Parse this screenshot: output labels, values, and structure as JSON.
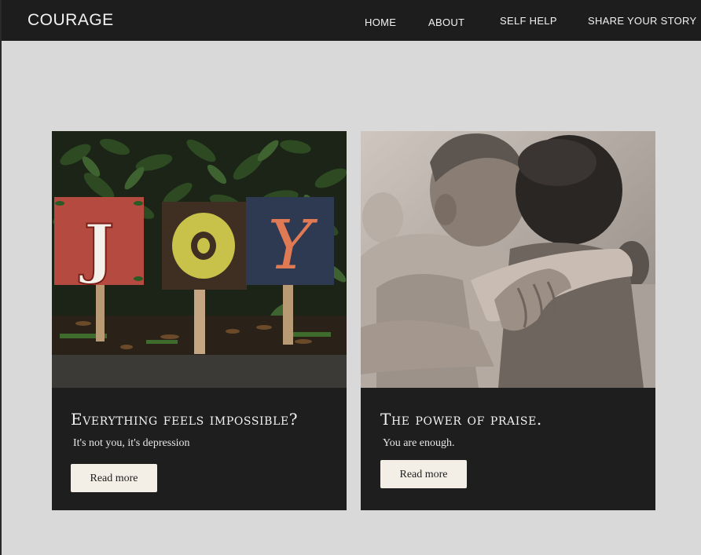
{
  "nav": {
    "brand": "COURAGE",
    "links": [
      "HOME",
      "ABOUT",
      "SELF HELP",
      "SHARE YOUR STORY"
    ]
  },
  "cards": [
    {
      "image_letters": [
        "J",
        "O",
        "Y"
      ],
      "title": "Everything feels impossible?",
      "subtitle": "It's not you, it's depression",
      "button": "Read more"
    },
    {
      "title": "The power of praise.",
      "subtitle": "You are enough.",
      "button": "Read more"
    }
  ],
  "colors": {
    "navbar": "#1d1d1d",
    "page_background": "#d9d9d9",
    "card_background": "#1e1e1e",
    "button_background": "#f3efe6"
  }
}
